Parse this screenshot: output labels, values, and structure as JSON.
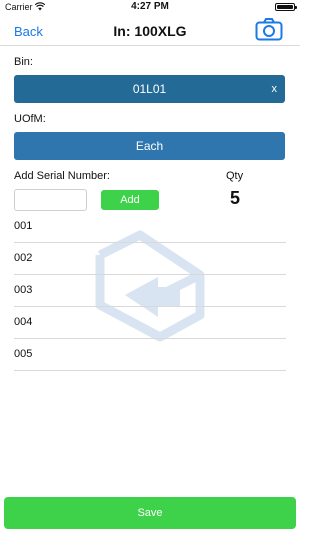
{
  "status_bar": {
    "carrier": "Carrier",
    "time": "4:27 PM"
  },
  "nav": {
    "back_label": "Back",
    "title": "In: 100XLG"
  },
  "form": {
    "bin_label": "Bin:",
    "bin_value": "01L01",
    "bin_clear": "x",
    "uofm_label": "UOfM:",
    "uofm_value": "Each",
    "serial_label": "Add Serial Number:",
    "serial_value": "",
    "add_label": "Add",
    "qty_label": "Qty",
    "qty_value": "5"
  },
  "serials": [
    {
      "label": "001"
    },
    {
      "label": "002"
    },
    {
      "label": "003"
    },
    {
      "label": "004"
    },
    {
      "label": "005"
    }
  ],
  "footer": {
    "save_label": "Save"
  },
  "colors": {
    "accent_blue": "#1a7ae6",
    "bar_blue": "#236b96",
    "green": "#3ed24a"
  },
  "icons": {
    "camera": "camera-icon",
    "wifi": "wifi-icon",
    "battery": "battery-icon",
    "watermark": "inbound-tray-icon"
  }
}
